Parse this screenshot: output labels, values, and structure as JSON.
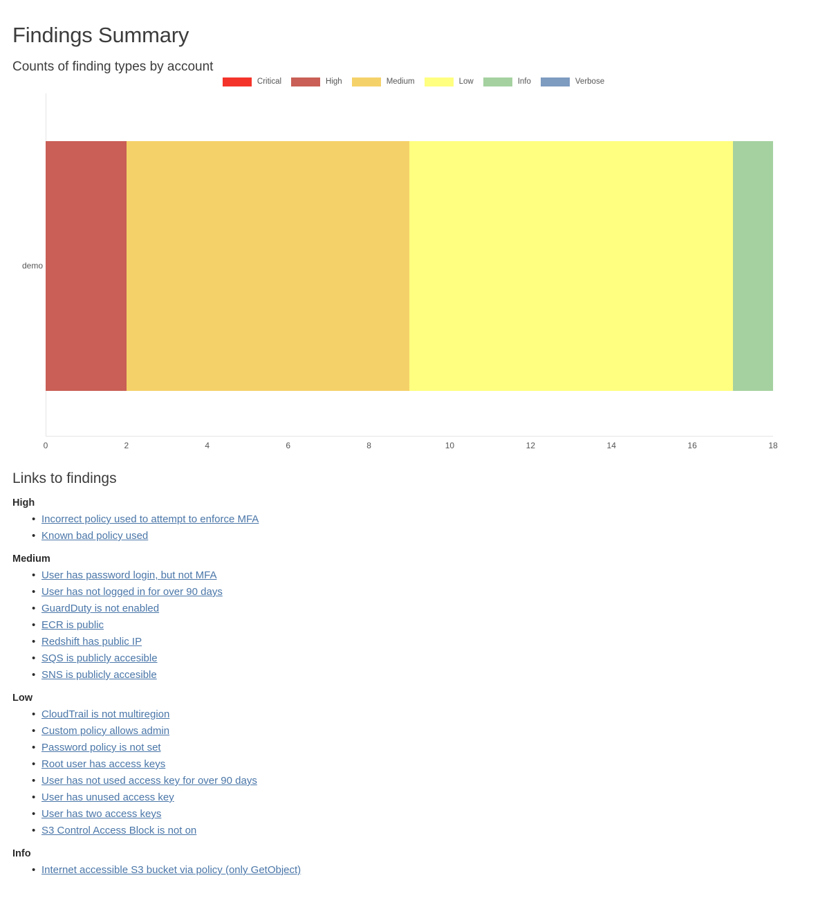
{
  "header": {
    "title": "Findings Summary",
    "subtitle": "Counts of finding types by account"
  },
  "chart_data": {
    "type": "bar",
    "orientation": "horizontal",
    "stacked": true,
    "title": "Counts of finding types by account",
    "xlabel": "",
    "ylabel": "",
    "categories": [
      "demo"
    ],
    "xticks": [
      "0",
      "2",
      "4",
      "6",
      "8",
      "10",
      "12",
      "14",
      "16",
      "18"
    ],
    "xtick_values": [
      0,
      2,
      4,
      6,
      8,
      10,
      12,
      14,
      16,
      18
    ],
    "xlim": [
      0,
      18
    ],
    "grid": false,
    "legend_position": "top-center",
    "series": [
      {
        "name": "Critical",
        "color": "#f4342a",
        "values": [
          0
        ]
      },
      {
        "name": "High",
        "color": "#c95f56",
        "values": [
          2
        ]
      },
      {
        "name": "Medium",
        "color": "#f5d169",
        "values": [
          7
        ]
      },
      {
        "name": "Low",
        "color": "#ffff80",
        "values": [
          8
        ]
      },
      {
        "name": "Info",
        "color": "#a5d1a0",
        "values": [
          1
        ]
      },
      {
        "name": "Verbose",
        "color": "#7e9bc0",
        "values": [
          0
        ]
      }
    ],
    "total": 18
  },
  "links": {
    "title": "Links to findings",
    "groups": [
      {
        "severity": "High",
        "items": [
          "Incorrect policy used to attempt to enforce MFA",
          "Known bad policy used"
        ]
      },
      {
        "severity": "Medium",
        "items": [
          "User has password login, but not MFA",
          "User has not logged in for over 90 days",
          "GuardDuty is not enabled",
          "ECR is public",
          "Redshift has public IP",
          "SQS is publicly accesible",
          "SNS is publicly accesible"
        ]
      },
      {
        "severity": "Low",
        "items": [
          "CloudTrail is not multiregion",
          "Custom policy allows admin",
          "Password policy is not set",
          "Root user has access keys",
          "User has not used access key for over 90 days",
          "User has unused access key",
          "User has two access keys",
          "S3 Control Access Block is not on"
        ]
      },
      {
        "severity": "Info",
        "items": [
          "Internet accessible S3 bucket via policy (only GetObject)"
        ]
      }
    ]
  }
}
